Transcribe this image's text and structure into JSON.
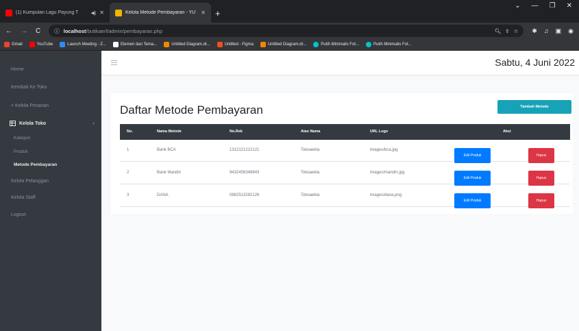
{
  "browser": {
    "tabs": [
      {
        "title": "(1) Kumpulan Lagu Payung T",
        "favicon_color": "#ff0000",
        "active": false
      },
      {
        "title": "Kelola Metode Pembayaran - YU",
        "favicon_color": "#f4b400",
        "active": true
      }
    ],
    "new_tab": "+",
    "url_host": "localhost",
    "url_path": "/butikaerl/admin/pembayaran.php",
    "bookmarks": [
      {
        "label": "Gmail",
        "color": "#ea4335"
      },
      {
        "label": "YouTube",
        "color": "#ff0000"
      },
      {
        "label": "Launch Meeting - Z...",
        "color": "#2d8cff"
      },
      {
        "label": "Elemen dan Tema...",
        "color": "#ffffff"
      },
      {
        "label": "Untitled Diagram.dr...",
        "color": "#f08705"
      },
      {
        "label": "Untitled - Figma",
        "color": "#f24e1e"
      },
      {
        "label": "Untitled Diagram.dr...",
        "color": "#f08705"
      },
      {
        "label": "Putih Minimalis Fot...",
        "color": "#00c4cc"
      },
      {
        "label": "Putih Minimalis Fot...",
        "color": "#00c4cc"
      }
    ]
  },
  "sidebar": {
    "items": [
      {
        "label": "Home"
      },
      {
        "label": "Kembali Ke Toko"
      },
      {
        "label": "< Kelola Pesanan"
      }
    ],
    "open_item": {
      "label": "Kelola Toko",
      "caret": "‹"
    },
    "sub_items": [
      {
        "label": "Kategori"
      },
      {
        "label": "Produk"
      },
      {
        "label": "Metode Pembayaran",
        "active": true
      }
    ],
    "bottom_items": [
      {
        "label": "Kelola Pelanggan"
      },
      {
        "label": "Kelola Staff"
      },
      {
        "label": "Logout"
      }
    ]
  },
  "header": {
    "date": "Sabtu, 4 Juni 2022"
  },
  "main": {
    "title": "Daftar Metode Pembayaran",
    "add_button": "Tambah Metode",
    "columns": [
      "No.",
      "Nama Metode",
      "No.Rek",
      "Atas Nama",
      "URL Logo",
      "Aksi"
    ],
    "rows": [
      {
        "no": "1",
        "nama": "Bank BCA",
        "norek": "1312121212121",
        "atas_nama": "Tokoaekta",
        "url": "images/bca.jpg"
      },
      {
        "no": "2",
        "nama": "Bank Mandiri",
        "norek": "9432456346843",
        "atas_nama": "Tokoaekta",
        "url": "images/mandiri.jpg"
      },
      {
        "no": "3",
        "nama": "DANA",
        "norek": "0882513282126",
        "atas_nama": "Tokoaekta",
        "url": "images/dana.png"
      }
    ],
    "edit_label": "Edit Produk",
    "delete_label": "Hapus"
  }
}
